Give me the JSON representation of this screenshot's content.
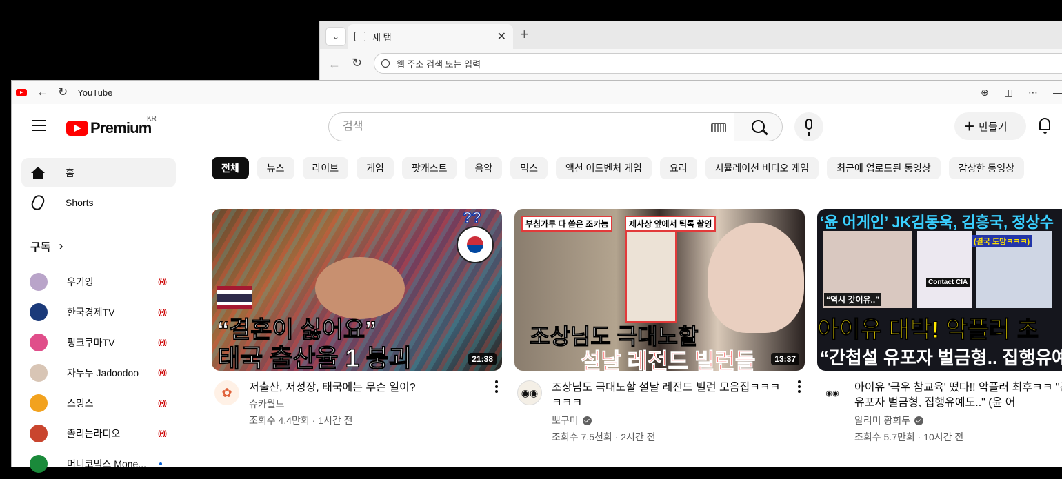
{
  "bg_browser": {
    "tab_title": "새 탭",
    "address_placeholder": "웹 주소 검색 또는 입력"
  },
  "app": {
    "title": "YouTube"
  },
  "header": {
    "brand": "Premium",
    "region": "KR",
    "search_placeholder": "검색",
    "create_label": "만들기"
  },
  "sidebar": {
    "home": "홈",
    "shorts": "Shorts",
    "subscriptions_heading": "구독",
    "subscriptions": [
      {
        "name": "우기잉",
        "status": "live",
        "color": "#b9a4c9"
      },
      {
        "name": "한국경제TV",
        "status": "live",
        "color": "#1b3a7a"
      },
      {
        "name": "핑크쿠마TV",
        "status": "live",
        "color": "#e04e8a"
      },
      {
        "name": "자두두 Jadoodoo",
        "status": "live",
        "color": "#d8c5b5"
      },
      {
        "name": "스밍스",
        "status": "live",
        "color": "#f2a21e"
      },
      {
        "name": "졸리는라디오",
        "status": "live",
        "color": "#c9452e"
      },
      {
        "name": "머니코믹스 Mone...",
        "status": "new",
        "color": "#1a8a3a"
      }
    ]
  },
  "chips": [
    "전체",
    "뉴스",
    "라이브",
    "게임",
    "팟캐스트",
    "음악",
    "믹스",
    "액션 어드벤처 게임",
    "요리",
    "시뮬레이션 비디오 게임",
    "최근에 업로드된 동영상",
    "감상한 동영상"
  ],
  "videos": [
    {
      "title": "저출산, 저성장, 태국에는 무슨 일이?",
      "channel": "슈카월드",
      "verified": false,
      "stats": "조회수 4.4만회 · 1시간 전",
      "duration": "21:38",
      "thumb_top": "??",
      "thumb_line1": "“결혼이 싫어요”",
      "thumb_line2": "태국 출산율 1 붕괴"
    },
    {
      "title": "조상님도 극대노할 설날 레전드 빌런 모음집ㅋㅋㅋㅋㅋㅋ",
      "channel": "뽀구미",
      "verified": true,
      "stats": "조회수 7.5천회 · 2시간 전",
      "duration": "13:37",
      "thumb_tag1": "부침가루 다 쏟은 조카놈",
      "thumb_tag2": "제사상 앞에서 틱톡 촬영",
      "thumb_line1": "조상님도 극대노할",
      "thumb_line2": "설날 레전드 빌런들"
    },
    {
      "title": "아이유 '극우 참교육' 떴다!! 악플러 최후ㅋㅋ \"간첩설 유포자 벌금형, 집행유예도..\" (윤 어",
      "channel": "알리미 황희두",
      "verified": true,
      "stats": "조회수 5.7만회 · 10시간 전",
      "thumb_top": "‘윤 어게인’ JK김동욱, 김흥국, 정상수",
      "thumb_caption": "“역시 갓이유..”",
      "thumb_badge": "(결국 도망ㅋㅋㅋ)",
      "thumb_cia": "Contact CIA",
      "thumb_line1": "아이유 대박! 악플러 초",
      "thumb_line2": "“간첩설 유포자 벌금형.. 집행유예"
    }
  ]
}
